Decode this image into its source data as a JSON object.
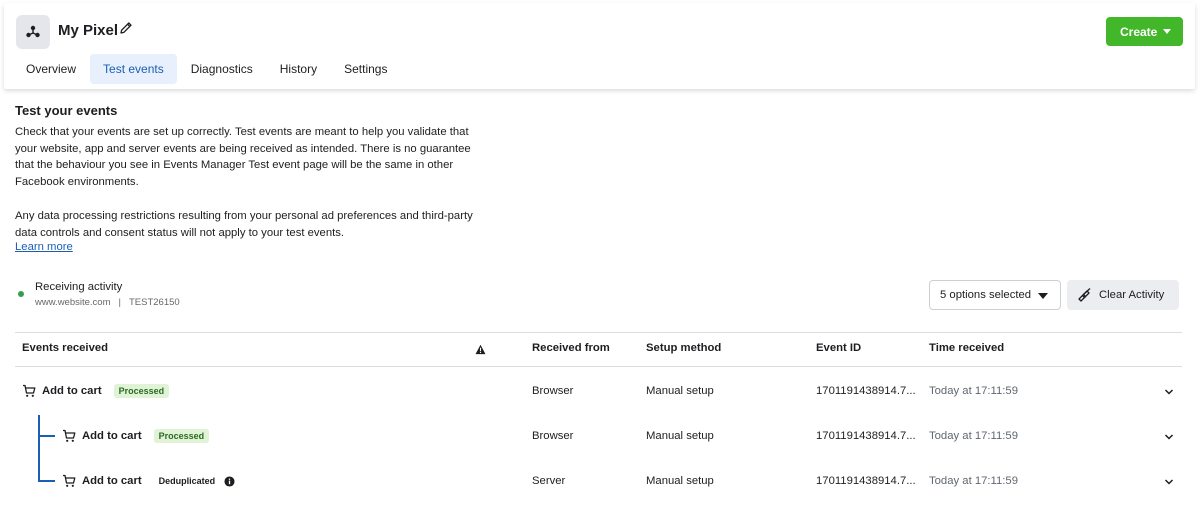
{
  "header": {
    "title": "My Pixel",
    "create_label": "Create",
    "tabs": [
      {
        "label": "Overview",
        "active": false
      },
      {
        "label": "Test events",
        "active": true
      },
      {
        "label": "Diagnostics",
        "active": false
      },
      {
        "label": "History",
        "active": false
      },
      {
        "label": "Settings",
        "active": false
      }
    ]
  },
  "intro": {
    "title": "Test your events",
    "paragraph1": "Check that your events are set up correctly. Test events are meant to help you validate that your website, app and server events are being received as intended. There is no guarantee that the behaviour you see in Events Manager Test event page will be the same in other Facebook environments.",
    "paragraph2": "Any data processing restrictions resulting from your personal ad preferences and third-party data controls and consent status will not apply to your test events.",
    "learn_more": "Learn more"
  },
  "activity": {
    "status": "Receiving activity",
    "website": "www.website.com",
    "separator": "|",
    "test_code": "TEST26150",
    "options_label": "5 options selected",
    "clear_label": "Clear Activity"
  },
  "table": {
    "headers": {
      "events": "Events received",
      "received_from": "Received from",
      "setup_method": "Setup method",
      "event_id": "Event ID",
      "time_received": "Time received"
    },
    "rows": [
      {
        "event": "Add to cart",
        "badge": "Processed",
        "from": "Browser",
        "setup": "Manual setup",
        "event_id": "1701191438914.7...",
        "time": "Today at 17:11:59"
      },
      {
        "event": "Add to cart",
        "badge": "Processed",
        "from": "Browser",
        "setup": "Manual setup",
        "event_id": "1701191438914.7...",
        "time": "Today at 17:11:59"
      },
      {
        "event": "Add to cart",
        "badge": "Deduplicated",
        "from": "Server",
        "setup": "Manual setup",
        "event_id": "1701191438914.7...",
        "time": "Today at 17:11:59"
      }
    ]
  },
  "colors": {
    "accent": "#1b5fb4",
    "create_green": "#42b72a",
    "processed_bg": "#e0f3d7",
    "status_green": "#31a24c"
  },
  "icons": [
    "pixel-icon",
    "pencil-icon",
    "caret-down-icon",
    "broom-icon",
    "warning-icon",
    "cart-icon",
    "info-icon",
    "chevron-down-icon"
  ]
}
